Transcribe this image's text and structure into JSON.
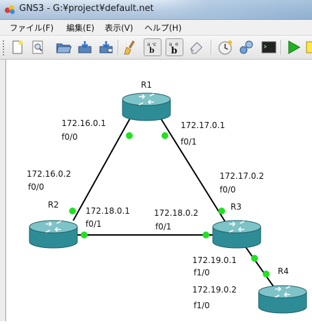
{
  "window": {
    "title": "GNS3 - G:¥project¥default.net"
  },
  "menu": [
    "ファイル(F)",
    "編集(E)",
    "表示(V)",
    "ヘルプ(H)"
  ],
  "toolbar": {
    "icons": [
      "new-file-icon",
      "zoom-icon",
      "open-folder-icon",
      "save-icon",
      "save-as-icon",
      "clear-icon",
      "interface-labels-icon",
      "hostname-labels-icon",
      "eraser-icon",
      "snapshot-icon",
      "link-icon",
      "console-icon",
      "start-icon",
      "note-icon"
    ]
  },
  "topology": {
    "routers": [
      {
        "name": "R1"
      },
      {
        "name": "R2"
      },
      {
        "name": "R3"
      },
      {
        "name": "R4"
      }
    ],
    "interfaces": {
      "r1_r2_r1side": {
        "ip": "172.16.0.1",
        "port": "f0/0"
      },
      "r1_r2_r2side": {
        "ip": "172.16.0.2",
        "port": "f0/0"
      },
      "r1_r3_r1side": {
        "ip": "172.17.0.1",
        "port": "f0/1"
      },
      "r1_r3_r3side": {
        "ip": "172.17.0.2",
        "port": "f0/0"
      },
      "r2_r3_r2side": {
        "ip": "172.18.0.1",
        "port": "f0/1"
      },
      "r2_r3_r3side": {
        "ip": "172.18.0.2",
        "port": "f0/1"
      },
      "r3_r4_r3side": {
        "ip": "172.19.0.1",
        "port": "f1/0"
      },
      "r3_r4_r4side": {
        "ip": "172.19.0.2",
        "port": "f1/0"
      }
    },
    "colors": {
      "router_body": "#2e8c96",
      "router_top": "#7ec3c8",
      "link": "#000000",
      "port_dot": "#22e022"
    }
  }
}
